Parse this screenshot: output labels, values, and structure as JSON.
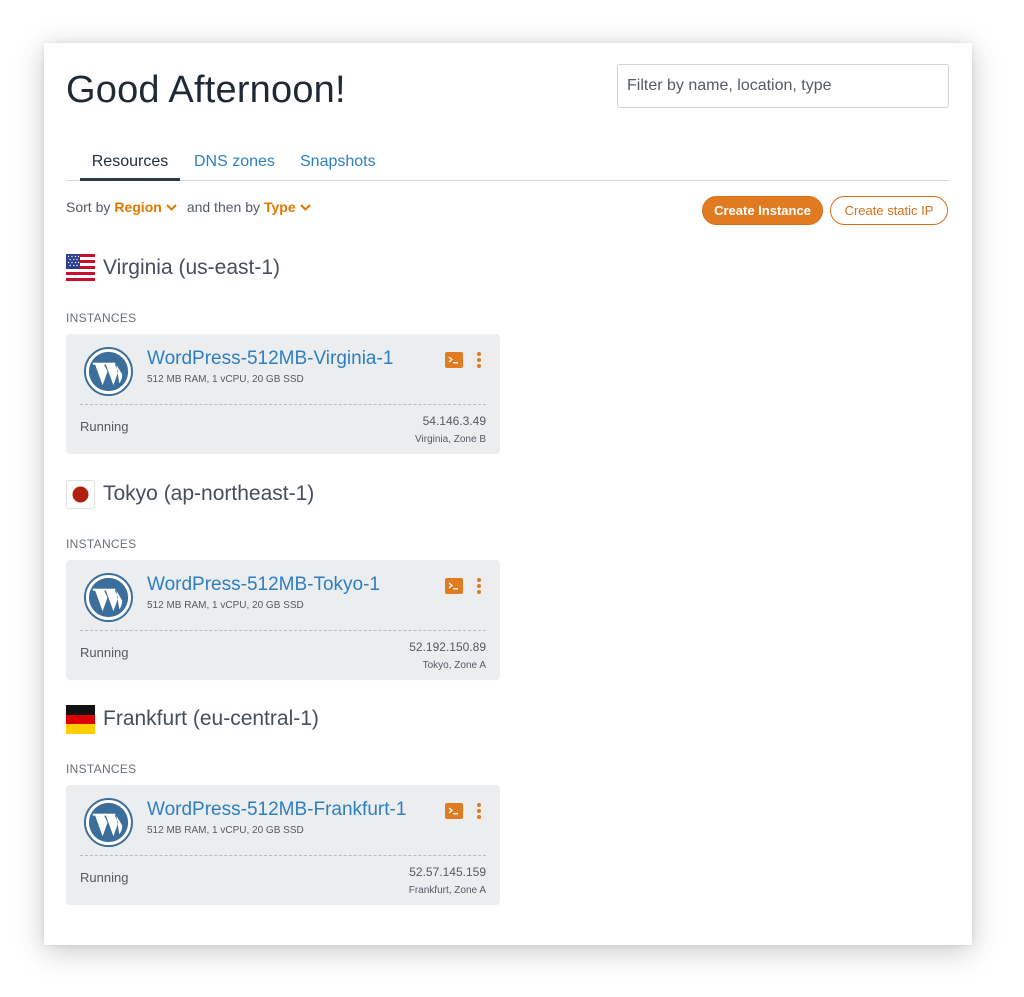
{
  "header": {
    "greeting": "Good Afternoon!",
    "filter_placeholder": "Filter by name, location, type"
  },
  "tabs": [
    {
      "label": "Resources",
      "active": true
    },
    {
      "label": "DNS zones",
      "active": false
    },
    {
      "label": "Snapshots",
      "active": false
    }
  ],
  "sort": {
    "prefix": "Sort by",
    "primary": "Region",
    "middle": "and then by",
    "secondary": "Type"
  },
  "actions": {
    "create_instance": "Create Instance",
    "create_static_ip": "Create static IP"
  },
  "regions": [
    {
      "name": "Virginia (us-east-1)",
      "flag": "us-flag-icon",
      "section": "INSTANCES",
      "instance": {
        "name": "WordPress-512MB-Virginia-1",
        "specs": "512 MB RAM, 1 vCPU, 20 GB SSD",
        "status": "Running",
        "ip": "54.146.3.49",
        "zone": "Virginia, Zone B"
      }
    },
    {
      "name": "Tokyo (ap-northeast-1)",
      "flag": "japan-flag-icon",
      "section": "INSTANCES",
      "instance": {
        "name": "WordPress-512MB-Tokyo-1",
        "specs": "512 MB RAM, 1 vCPU, 20 GB SSD",
        "status": "Running",
        "ip": "52.192.150.89",
        "zone": "Tokyo, Zone A"
      }
    },
    {
      "name": "Frankfurt (eu-central-1)",
      "flag": "germany-flag-icon",
      "section": "INSTANCES",
      "instance": {
        "name": "WordPress-512MB-Frankfurt-1",
        "specs": "512 MB RAM, 1 vCPU, 20 GB SSD",
        "status": "Running",
        "ip": "52.57.145.159",
        "zone": "Frankfurt, Zone A"
      }
    }
  ],
  "colors": {
    "accent": "#e07b22",
    "link": "#2d7fc1",
    "card": "#ebedef"
  }
}
